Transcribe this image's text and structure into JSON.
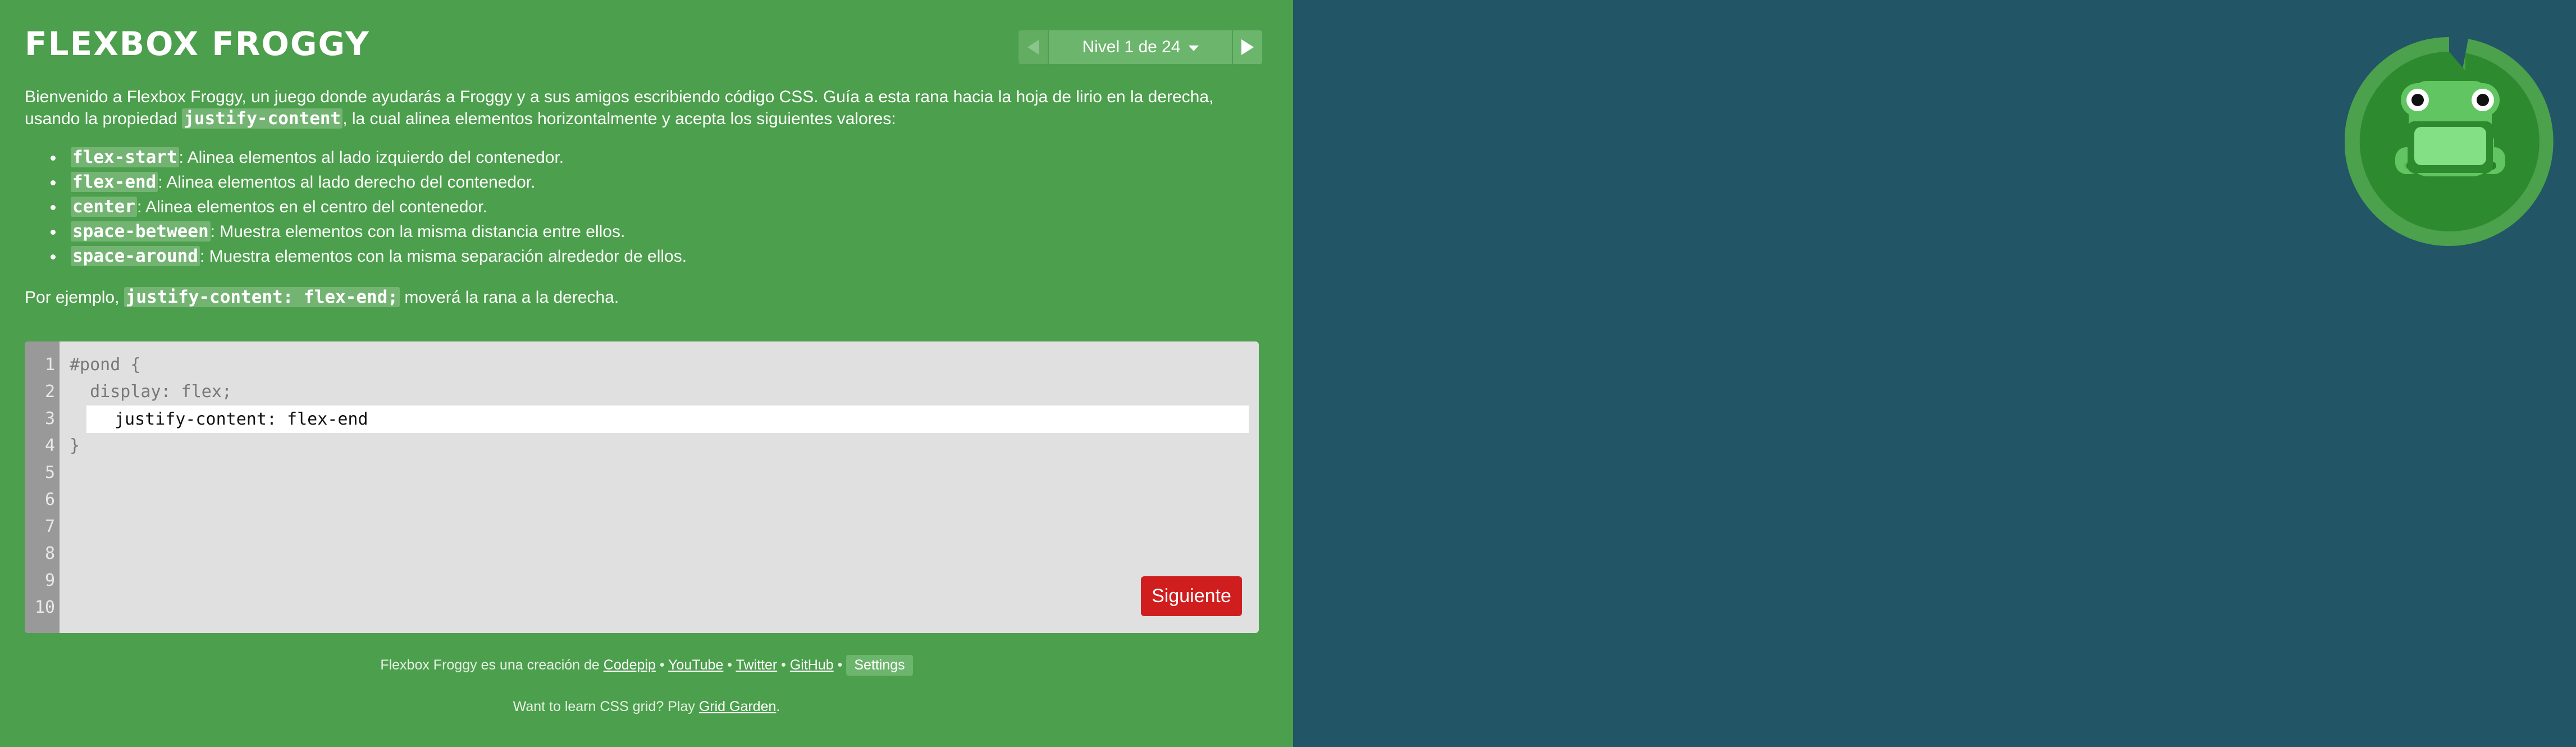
{
  "app": {
    "title": "FLEXBOX FROGGY"
  },
  "level_nav": {
    "indicator_text": "Nivel 1 de 24",
    "prev_icon": "triangle-left-icon",
    "next_icon": "triangle-right-icon",
    "dropdown_icon": "caret-down-icon"
  },
  "instructions": {
    "intro_part1": "Bienvenido a Flexbox Froggy, un juego donde ayudarás a Froggy y a sus amigos escribiendo código CSS. Guía a esta rana hacia la hoja de lirio en la derecha, usando la propiedad ",
    "intro_code": "justify-content",
    "intro_part2": ", la cual alinea elementos horizontalmente y acepta los siguientes valores:",
    "values": [
      {
        "code": "flex-start",
        "desc": ": Alinea elementos al lado izquierdo del contenedor."
      },
      {
        "code": "flex-end",
        "desc": ": Alinea elementos al lado derecho del contenedor."
      },
      {
        "code": "center",
        "desc": ": Alinea elementos en el centro del contenedor."
      },
      {
        "code": "space-between",
        "desc": ": Muestra elementos con la misma distancia entre ellos."
      },
      {
        "code": "space-around",
        "desc": ": Muestra elementos con la misma separación alrededor de ellos."
      }
    ],
    "example_prefix": "Por ejemplo, ",
    "example_code": "justify-content: flex-end;",
    "example_suffix": " moverá la rana a la derecha."
  },
  "editor": {
    "line_numbers": [
      "1",
      "2",
      "3",
      "4",
      "5",
      "6",
      "7",
      "8",
      "9",
      "10"
    ],
    "line1": "#pond {",
    "line2": "  display: flex;",
    "input_value": "justify-content: flex-end",
    "line4": "}",
    "next_label": "Siguiente"
  },
  "footer": {
    "credit_prefix": "Flexbox Froggy es una creación de ",
    "codepip": "Codepip",
    "sep": " • ",
    "youtube": "YouTube",
    "twitter": "Twitter",
    "github": "GitHub",
    "settings": "Settings",
    "grid_prefix": "Want to learn CSS grid? Play ",
    "grid_link": "Grid Garden",
    "grid_suffix": "."
  },
  "colors": {
    "sidebar_bg": "#4c9f4c",
    "pond_bg": "#225566",
    "next_button": "#d01e1e",
    "editor_bg": "#e0e0e0",
    "lilypad": "#4ca14c",
    "frog": "#61c661"
  },
  "icons": {
    "frog": "frog-icon",
    "lilypad": "lilypad-icon"
  }
}
